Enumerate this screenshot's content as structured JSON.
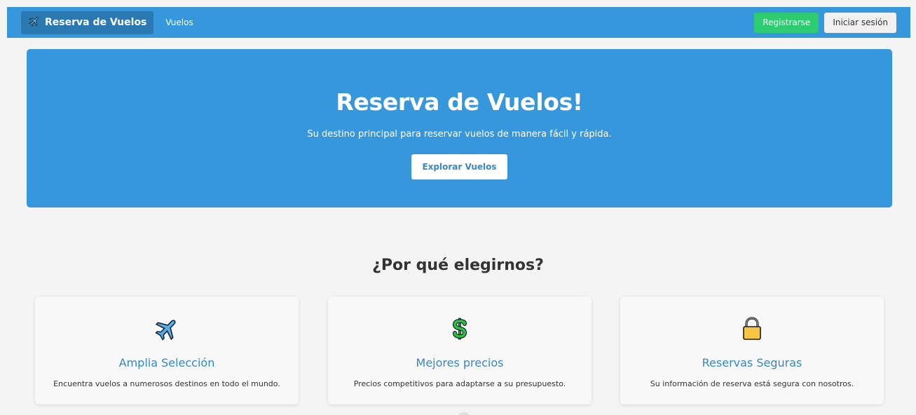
{
  "navbar": {
    "brand_label": "Reserva de Vuelos",
    "brand_icon": "airplane-icon",
    "links": [
      "Vuelos"
    ],
    "register_label": "Registrarse",
    "login_label": "Iniciar sesión",
    "colors": {
      "navbar_bg": "#3797dc",
      "brand_bg": "#2a79b3",
      "register_bg": "#2ecc71"
    }
  },
  "hero": {
    "title": "Reserva de Vuelos!",
    "subtitle": "Su destino principal para reservar vuelos de manera fácil y rápida.",
    "cta_label": "Explorar Vuelos"
  },
  "features": {
    "heading": "¿Por qué elegirnos?",
    "items": [
      {
        "icon": "airplane-icon",
        "title": "Amplia Selección",
        "description": "Encuentra vuelos a numerosos destinos en todo el mundo."
      },
      {
        "icon": "dollar-icon",
        "title": "Mejores precios",
        "description": "Precios competitivos para adaptarse a su presupuesto."
      },
      {
        "icon": "lock-icon",
        "title": "Reservas Seguras",
        "description": "Su información de reserva está segura con nosotros."
      }
    ]
  }
}
